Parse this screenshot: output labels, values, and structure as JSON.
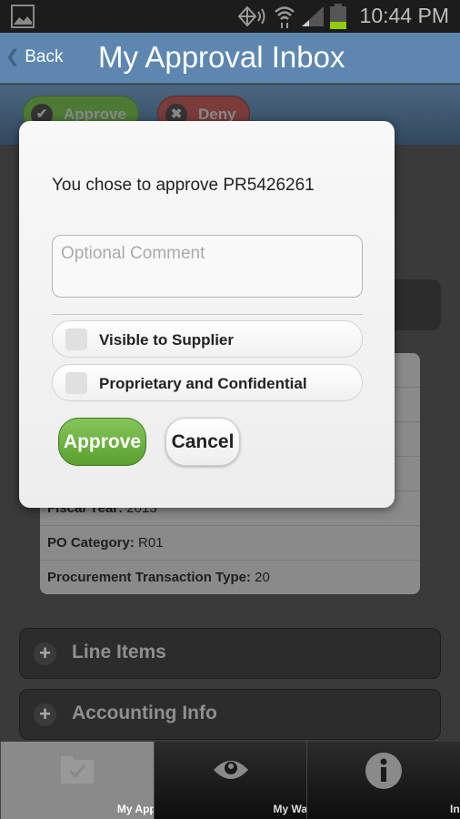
{
  "status_bar": {
    "time": "10:44 PM",
    "icons": [
      "image-icon",
      "nfc-icon",
      "wifi-icon",
      "signal-icon",
      "battery-icon"
    ],
    "battery_color": "#8fcc00"
  },
  "header": {
    "back_label": "Back",
    "title": "My Approval Inbox"
  },
  "toolbar": {
    "approve_label": "Approve",
    "deny_label": "Deny"
  },
  "details": {
    "rows": [
      {
        "label": "Fiscal Year:",
        "value": "2013"
      },
      {
        "label": "PO Category:",
        "value": "R01"
      },
      {
        "label": "Procurement Transaction Type:",
        "value": "20"
      }
    ]
  },
  "sections": [
    {
      "label": "Line Items"
    },
    {
      "label": "Accounting Info"
    }
  ],
  "tabs": [
    {
      "label": "My Approvers",
      "icon": "folder-check-icon",
      "active": true
    },
    {
      "label": "My Watchers",
      "icon": "eye-icon"
    },
    {
      "label": "Info",
      "icon": "info-icon"
    }
  ],
  "modal": {
    "message": "You chose to approve PR5426261",
    "comment_placeholder": "Optional Comment",
    "comment_value": "",
    "checkboxes": [
      {
        "label": "Visible to Supplier",
        "checked": false
      },
      {
        "label": "Proprietary and Confidential",
        "checked": false
      }
    ],
    "approve_label": "Approve",
    "cancel_label": "Cancel",
    "approve_color": "#5fa532"
  }
}
